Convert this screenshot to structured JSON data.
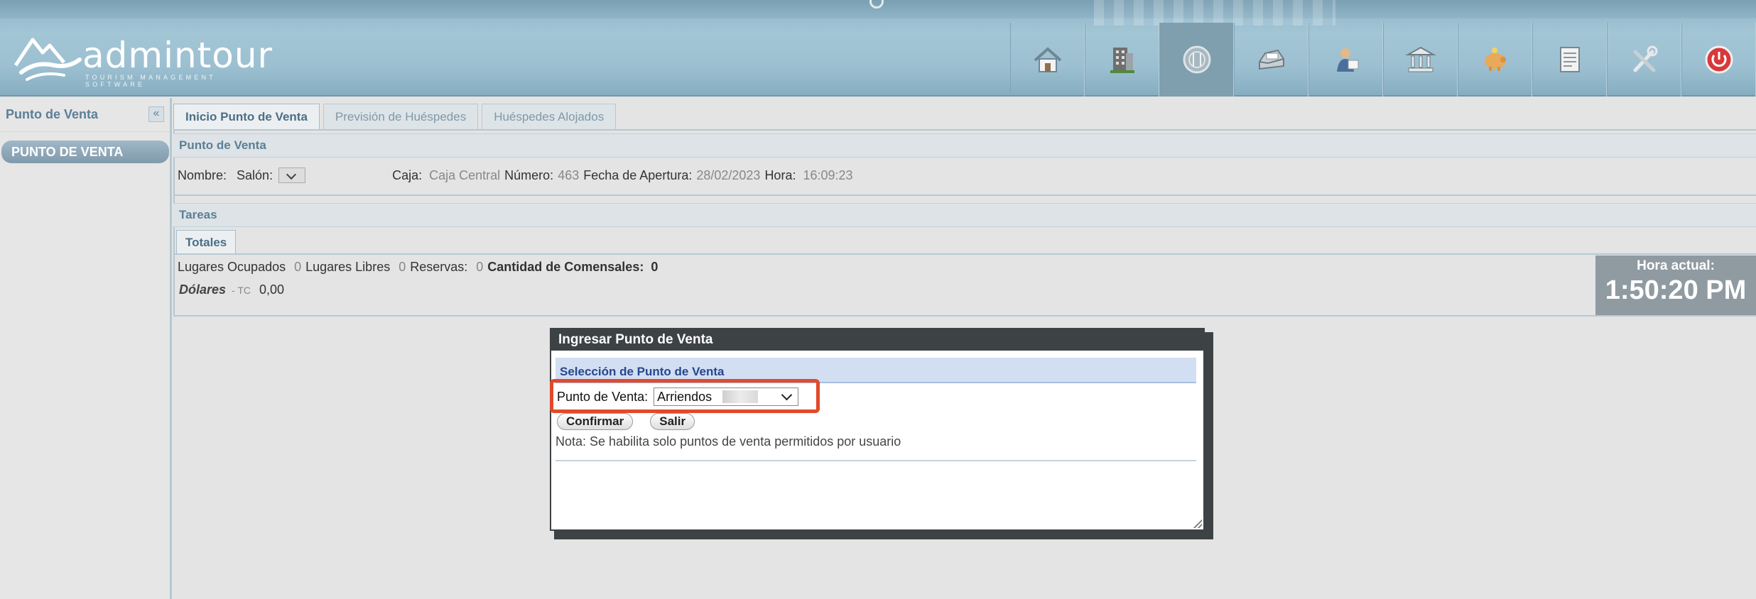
{
  "header": {
    "logo_text": "admintour",
    "logo_sub": "TOURISM MANAGEMENT SOFTWARE",
    "nav_icons": [
      "home-icon",
      "building-icon",
      "dining-icon",
      "tray-icon",
      "person-icon",
      "bank-icon",
      "piggy-bank-icon",
      "document-icon",
      "tools-icon",
      "power-icon"
    ]
  },
  "sidebar": {
    "title": "Punto de Venta",
    "collapse_symbol": "«",
    "item": "PUNTO DE VENTA"
  },
  "tabs": [
    "Inicio Punto de Venta",
    "Previsión de Huéspedes",
    "Huéspedes Alojados"
  ],
  "punto_venta": {
    "section_title": "Punto de Venta",
    "nombre_label": "Nombre:",
    "salon_label": "Salón:",
    "caja_label": "Caja:",
    "caja_value": "Caja Central",
    "numero_label": "Número:",
    "numero_value": "463",
    "fecha_label": "Fecha de Apertura:",
    "fecha_value": "28/02/2023",
    "hora_label": "Hora:",
    "hora_value": "16:09:23"
  },
  "tareas": {
    "section_title": "Tareas",
    "subtab": "Totales",
    "ocupados_label": "Lugares Ocupados",
    "ocupados_value": "0",
    "libres_label": "Lugares Libres",
    "libres_value": "0",
    "reservas_label": "Reservas:",
    "reservas_value": "0",
    "comensales_label": "Cantidad de Comensales:",
    "comensales_value": "0",
    "dolares_label": "Dólares",
    "tc_label": "- TC",
    "tc_value": "0,00"
  },
  "clock": {
    "label": "Hora actual:",
    "time": "1:50:20 PM"
  },
  "dialog": {
    "title": "Ingresar Punto de Venta",
    "section_title": "Selección de Punto de Venta",
    "field_label": "Punto de Venta:",
    "selected_value": "Arriendos",
    "confirm_label": "Confirmar",
    "exit_label": "Salir",
    "note": "Nota: Se habilita solo puntos de venta permitidos por usuario"
  },
  "colors": {
    "highlight": "#e04a2a",
    "header": "#9cc0d1",
    "dialog_title": "#3d4245"
  }
}
